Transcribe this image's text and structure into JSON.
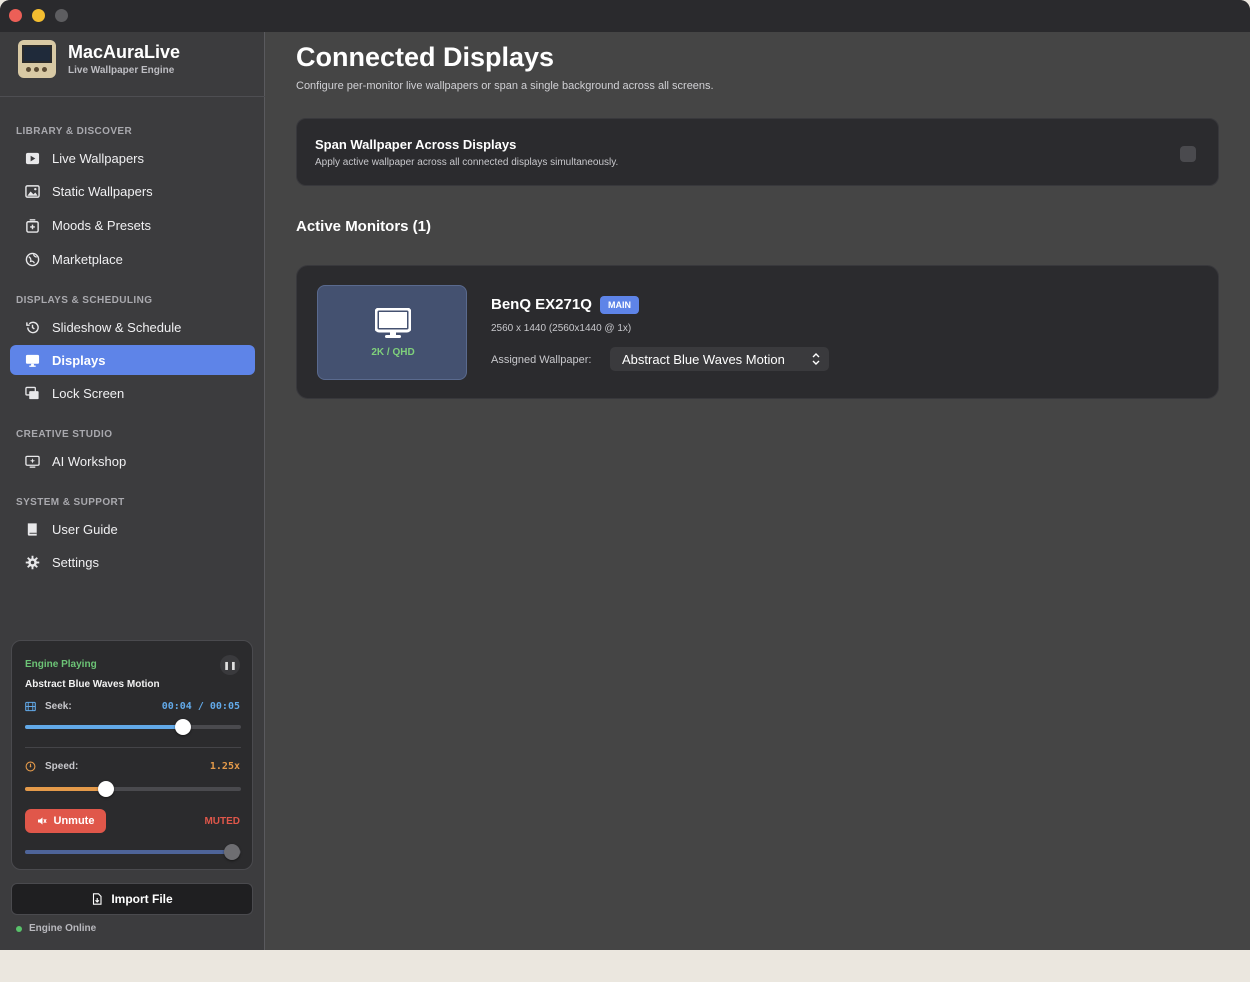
{
  "brand": {
    "name": "MacAuraLive",
    "subtitle": "Live Wallpaper Engine"
  },
  "sidebar": {
    "sections": [
      {
        "title": "LIBRARY & DISCOVER",
        "items": [
          {
            "label": "Live Wallpapers",
            "icon": "play-icon"
          },
          {
            "label": "Static Wallpapers",
            "icon": "image-icon"
          },
          {
            "label": "Moods & Presets",
            "icon": "preset-icon"
          },
          {
            "label": "Marketplace",
            "icon": "globe-icon"
          }
        ]
      },
      {
        "title": "DISPLAYS & SCHEDULING",
        "items": [
          {
            "label": "Slideshow & Schedule",
            "icon": "history-icon"
          },
          {
            "label": "Displays",
            "icon": "monitor-icon",
            "active": true
          },
          {
            "label": "Lock Screen",
            "icon": "windows-icon"
          }
        ]
      },
      {
        "title": "CREATIVE STUDIO",
        "items": [
          {
            "label": "AI Workshop",
            "icon": "ai-screen-icon"
          }
        ]
      },
      {
        "title": "SYSTEM & SUPPORT",
        "items": [
          {
            "label": "User Guide",
            "icon": "book-icon"
          },
          {
            "label": "Settings",
            "icon": "gear-icon"
          }
        ]
      }
    ]
  },
  "engine": {
    "status": "Engine Playing",
    "title": "Abstract Blue Waves Motion",
    "seek_label": "Seek:",
    "seek_time": "00:04 / 00:05",
    "seek_fraction": 0.73,
    "speed_label": "Speed:",
    "speed_value": "1.25x",
    "speed_fraction": 0.375,
    "unmute_label": "Unmute",
    "muted_label": "MUTED",
    "volume_fraction": 0.96,
    "colors": {
      "seek": "#62a9e8",
      "speed": "#e49a4a",
      "volume": "#4e6499",
      "status": "#6cc476",
      "mute": "#e0574a"
    }
  },
  "import_label": "Import File",
  "online_label": "Engine Online",
  "main": {
    "title": "Connected Displays",
    "subtitle": "Configure per-monitor live wallpapers or span a single background across all screens.",
    "span": {
      "title": "Span Wallpaper Across Displays",
      "desc": "Apply active wallpaper across all connected displays simultaneously.",
      "enabled": false
    },
    "monitors_heading": "Active Monitors (1)",
    "monitor": {
      "thumb_label": "2K / QHD",
      "name": "BenQ EX271Q",
      "badge": "MAIN",
      "resolution": "2560 x 1440 (2560x1440 @ 1x)",
      "assign_label": "Assigned Wallpaper:",
      "wallpaper": "Abstract Blue Waves Motion"
    }
  }
}
